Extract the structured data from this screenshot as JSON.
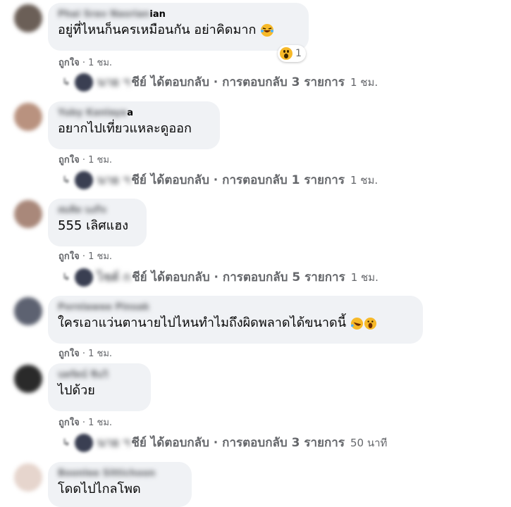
{
  "comments": [
    {
      "author_visible": "ian",
      "author_blurred": "Phai Srav Nasrian",
      "text": "อยู่ที่ไหนก็นครเหมือนกัน อย่าคิดมาก",
      "reaction_count": "1",
      "reaction_icon": "wow-reaction-icon",
      "like": "ถูกใจ",
      "time": "1 ชม.",
      "reply_prefix_blurred": "นาย ฯ",
      "reply_name_visible": "ชีย์",
      "reply_text": "ได้ตอบกลับ · การตอบกลับ 3 รายการ",
      "reply_time": "1 ชม.",
      "avatar_color": "#6b5f57"
    },
    {
      "author_visible": "a",
      "author_blurred": "Yuby Kanlaya",
      "text": "อยากไปเที่ยวแหละดูออก",
      "like": "ถูกใจ",
      "time": "1 ชม.",
      "reply_prefix_blurred": "นาย ฯ",
      "reply_name_visible": "ชีย์",
      "reply_text": "ได้ตอบกลับ · การตอบกลับ 1 รายการ",
      "reply_time": "1 ชม.",
      "avatar_color": "#b9927f"
    },
    {
      "author_visible": "",
      "author_blurred": "สมคิด นงกิจ",
      "text": "555 เลิศแฮง",
      "like": "ถูกใจ",
      "time": "1 ชม.",
      "reply_prefix_blurred": "ไชต์ ก",
      "reply_name_visible": "ชีย์",
      "reply_text": "ได้ตอบกลับ · การตอบกลับ 5 รายการ",
      "reply_time": "1 ชม.",
      "avatar_color": "#a9887a"
    },
    {
      "author_visible": "",
      "author_blurred": "Pornlawee Pinsak",
      "text": "ใครเอาแว่นตานายไปไหนทำไมถึงผิดพลาดได้ขนาดนี้",
      "like": "ถูกใจ",
      "time": "1 ชม.",
      "avatar_color": "#5d6271"
    },
    {
      "author_visible": "",
      "author_blurred": "นพรัตน์ ชินวิ",
      "text": "ไปด้วย",
      "like": "ถูกใจ",
      "time": "1 ชม.",
      "reply_prefix_blurred": "นาย ฯ",
      "reply_name_visible": "ชีย์",
      "reply_text": "ได้ตอบกลับ · การตอบกลับ 3 รายการ",
      "reply_time": "50 นาที",
      "avatar_color": "#2a2a2a"
    },
    {
      "author_visible": "",
      "author_blurred": "Boonlee Sittichoon",
      "text": "โดดไปไกลโพด",
      "avatar_color": "#e6d5cd"
    }
  ]
}
